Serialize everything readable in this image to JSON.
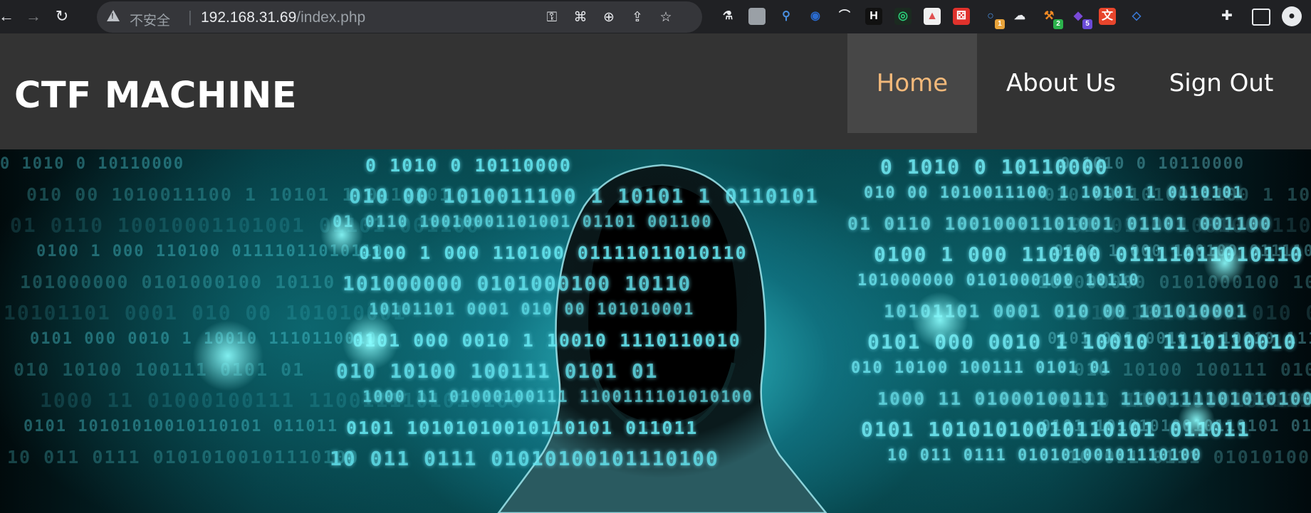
{
  "browser": {
    "security_label": "不安全",
    "url_host": "192.168.31.69",
    "url_path": "/index.php",
    "extensions": [
      {
        "name": "extension-flask-icon",
        "color": "#e8eaed",
        "bg": "transparent",
        "glyph": "⚗"
      },
      {
        "name": "extension-bar-icon",
        "color": "#bdc1c6",
        "bg": "#9aa0a6",
        "glyph": ""
      },
      {
        "name": "extension-pin-icon",
        "color": "#4a90e2",
        "bg": "transparent",
        "glyph": "⚲"
      },
      {
        "name": "extension-eye-icon",
        "color": "#2a6bd0",
        "bg": "transparent",
        "glyph": "◉"
      },
      {
        "name": "extension-hat-icon",
        "color": "#e8eaed",
        "bg": "transparent",
        "glyph": "⌒"
      },
      {
        "name": "extension-h-icon",
        "color": "#ffffff",
        "bg": "#111111",
        "glyph": "H"
      },
      {
        "name": "extension-circle-icon",
        "color": "#2bd07a",
        "bg": "#1b2a20",
        "glyph": "◎"
      },
      {
        "name": "extension-lock-icon",
        "color": "#e05050",
        "bg": "#f0f0f0",
        "glyph": "▲"
      },
      {
        "name": "extension-dice-icon",
        "color": "#ffffff",
        "bg": "#e0322c",
        "glyph": "⚄"
      },
      {
        "name": "extension-search-badge-icon",
        "color": "#4a90e2",
        "bg": "transparent",
        "glyph": "○",
        "badge": "1",
        "badge_color": "#e8a33a"
      },
      {
        "name": "extension-cloud-icon",
        "color": "#e8eaed",
        "bg": "transparent",
        "glyph": "☁"
      },
      {
        "name": "extension-tool-icon",
        "color": "#f08a24",
        "bg": "transparent",
        "glyph": "⚒",
        "badge": "2",
        "badge_color": "#2bb24c"
      },
      {
        "name": "extension-gem-icon",
        "color": "#7a4ad8",
        "bg": "transparent",
        "glyph": "◆",
        "badge": "5",
        "badge_color": "#6a4ad8"
      },
      {
        "name": "extension-translate-icon",
        "color": "#ffffff",
        "bg": "#e8452c",
        "glyph": "文"
      },
      {
        "name": "extension-leaf-icon",
        "color": "#3a7ad8",
        "bg": "transparent",
        "glyph": "◇"
      }
    ]
  },
  "site": {
    "brand": "CTF MACHINE",
    "nav": [
      {
        "label": "Home",
        "active": true
      },
      {
        "label": "About Us",
        "active": false
      },
      {
        "label": "Sign Out",
        "active": false
      }
    ]
  },
  "hero": {
    "binary_rows": [
      "0 1010 0 10110000",
      "010 00 1010011100 1 10101 1 0110101",
      "01 0110 10010001101001 01101 001100",
      "0100 1 000 110100 01111011010110",
      "101000000 0101000100 10110",
      "10101101 0001 010 00 101010001",
      "0101 000 0010 1 10010 1110110010",
      "010 10100 100111 0101 01",
      "1000 11 01000100111 1100111101010100",
      "0101 10101010010110101 011011",
      "10 011 0111 01010100101110100"
    ]
  }
}
